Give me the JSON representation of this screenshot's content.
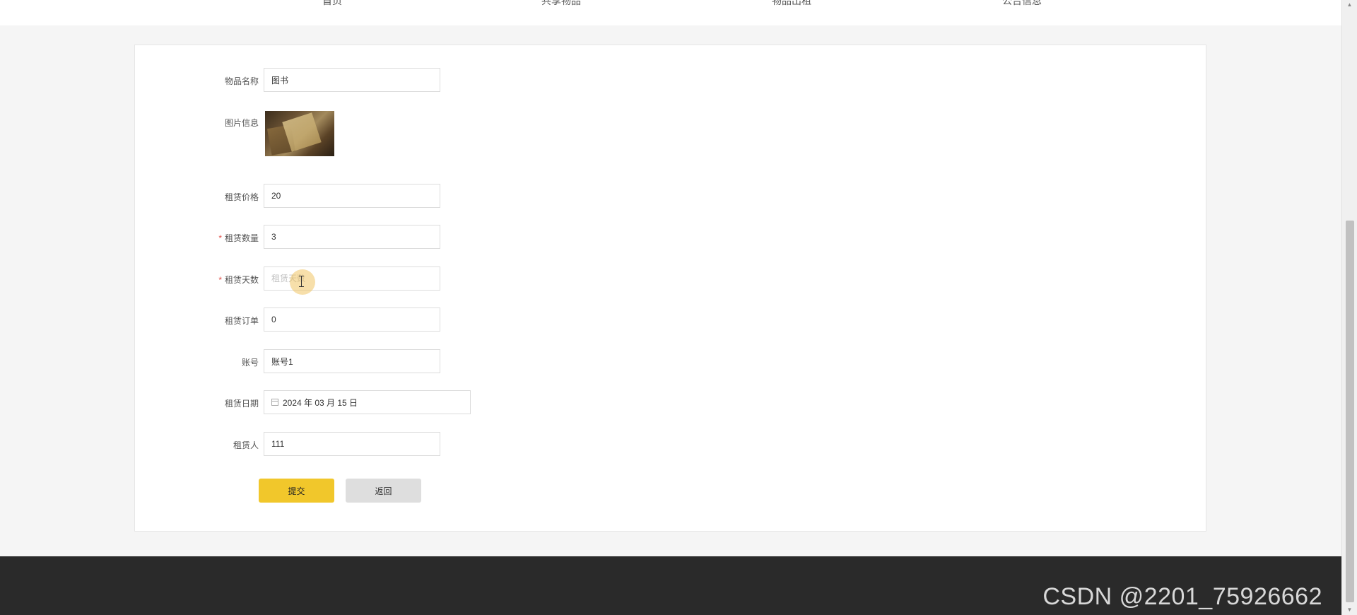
{
  "nav": {
    "items": [
      "首页",
      "共享物品",
      "物品出租",
      "公告信息"
    ]
  },
  "form": {
    "item_name": {
      "label": "物品名称",
      "value": "图书"
    },
    "image": {
      "label": "图片信息"
    },
    "price": {
      "label": "租赁价格",
      "value": "20"
    },
    "quantity": {
      "label": "租赁数量",
      "value": "3",
      "required_mark": "*"
    },
    "days": {
      "label": "租赁天数",
      "value": "",
      "placeholder": "租赁天数",
      "required_mark": "*"
    },
    "order": {
      "label": "租赁订单",
      "value": "0"
    },
    "account": {
      "label": "账号",
      "value": "账号1"
    },
    "date": {
      "label": "租赁日期",
      "value": "2024 年 03 月 15 日"
    },
    "renter": {
      "label": "租赁人",
      "value": "111"
    }
  },
  "buttons": {
    "submit_label": "提交",
    "back_label": "返回"
  },
  "watermark": "CSDN @2201_75926662",
  "colors": {
    "submit_bg": "#f1c72b",
    "back_bg": "#dedede",
    "footer_bg": "#2a2a2a",
    "required": "#e0504a"
  }
}
